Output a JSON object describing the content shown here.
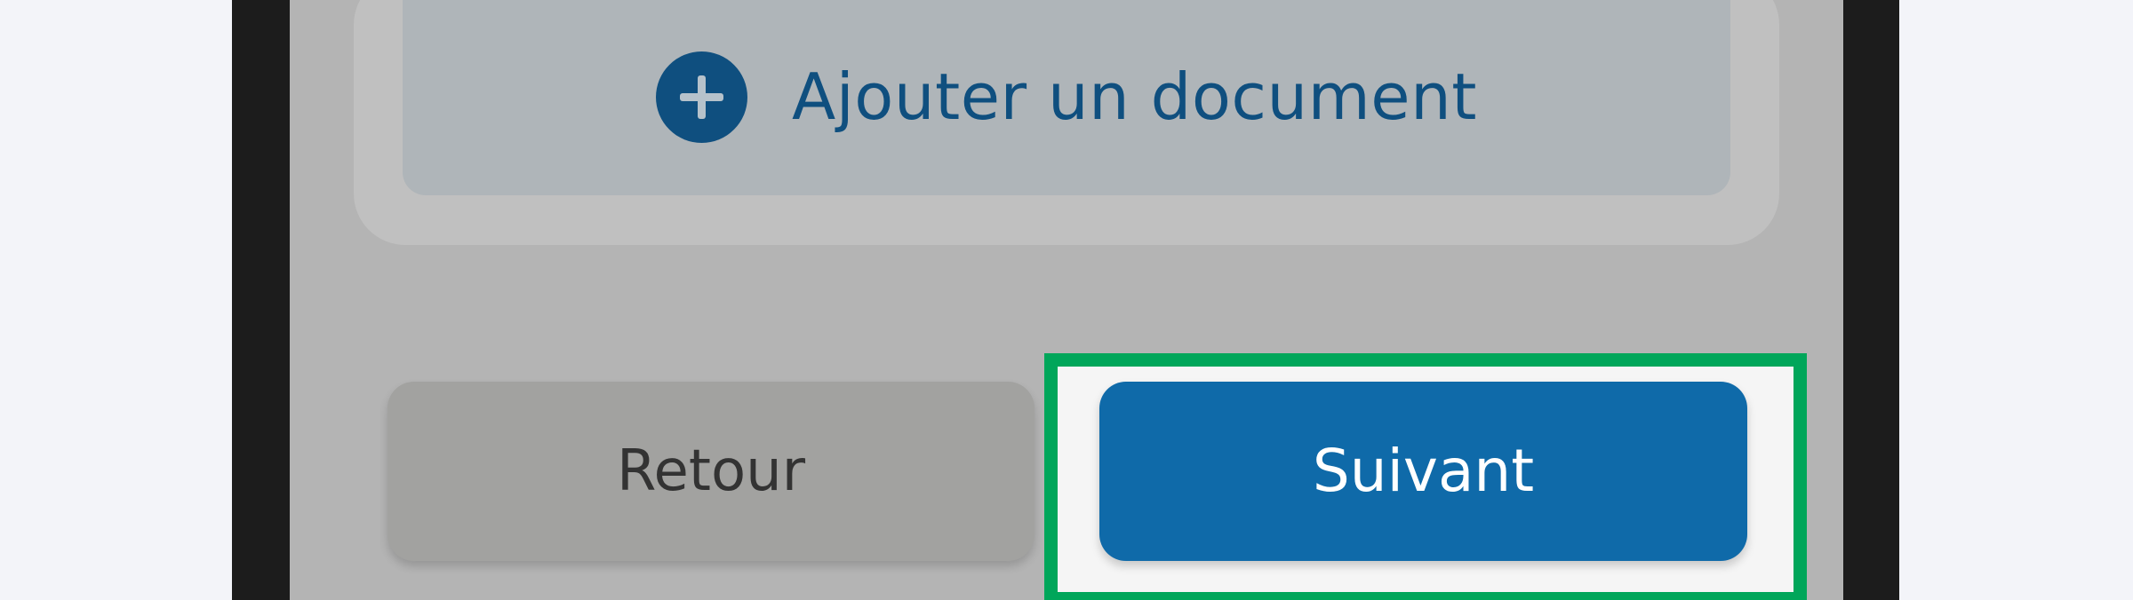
{
  "upload": {
    "add_document_label": "Ajouter un document",
    "icon": "plus-circle-icon"
  },
  "actions": {
    "back_label": "Retour",
    "next_label": "Suivant"
  },
  "highlight": {
    "target": "next-button",
    "color": "#00a65a"
  },
  "colors": {
    "page_background": "#f3f4f9",
    "device_frame": "#1c1c1c",
    "overlay": "#b4b4b4",
    "primary": "#0f6aa9",
    "secondary": "#a2a2a0"
  }
}
